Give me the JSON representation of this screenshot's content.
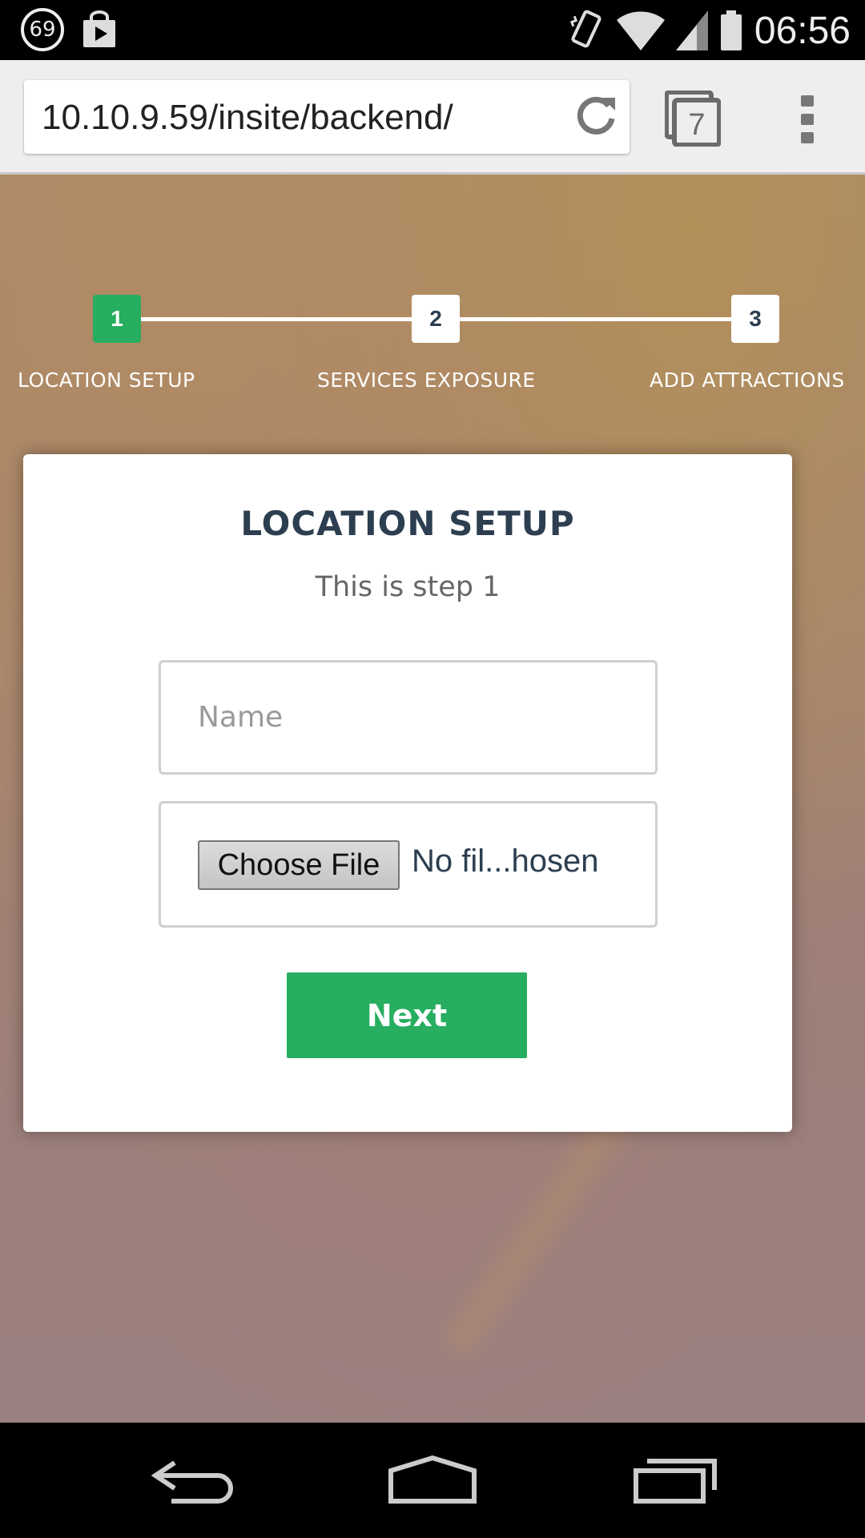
{
  "status_bar": {
    "notification_count": "69",
    "notification_icon": "circled-number-icon",
    "store_icon": "play-store-bag-icon",
    "vibrate_icon": "vibrate-icon",
    "wifi_icon": "wifi-icon",
    "signal_icon": "cell-signal-icon",
    "battery_icon": "battery-icon",
    "time": "06:56"
  },
  "browser": {
    "url": "10.10.9.59/insite/backend/",
    "reload_icon": "reload-icon",
    "tab_count": "7",
    "menu_icon": "overflow-menu-icon"
  },
  "stepper": {
    "steps": [
      {
        "number": "1",
        "label": "LOCATION SETUP",
        "active": true
      },
      {
        "number": "2",
        "label": "SERVICES EXPOSURE",
        "active": false
      },
      {
        "number": "3",
        "label": "ADD ATTRACTIONS",
        "active": false
      }
    ]
  },
  "card": {
    "title": "LOCATION SETUP",
    "subtitle": "This is step 1",
    "name_placeholder": "Name",
    "name_value": "",
    "choose_file_label": "Choose File",
    "file_status": "No fil...hosen",
    "next_label": "Next"
  },
  "colors": {
    "accent": "#27ae60",
    "title": "#2c3e50",
    "browser_bar": "#eeeeee"
  },
  "nav_bar": {
    "back_icon": "back-icon",
    "home_icon": "home-icon",
    "recents_icon": "recents-icon"
  }
}
